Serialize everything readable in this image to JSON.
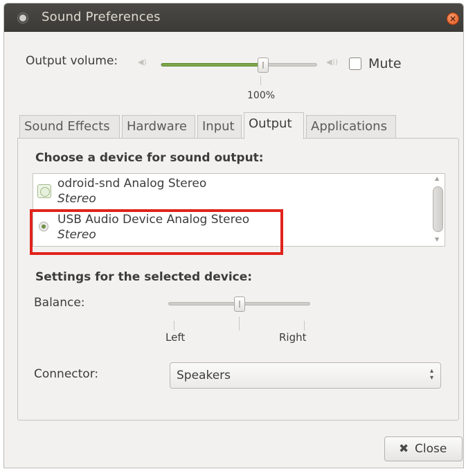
{
  "window": {
    "title": "Sound Preferences",
    "title_icon": "speaker-icon",
    "close_icon": "close-icon"
  },
  "volume": {
    "label": "Output volume:",
    "level_percent": 100,
    "value_text": "100%",
    "mute_label": "Mute",
    "muted": false,
    "low_icon": "speaker-low-icon",
    "high_icon": "speaker-high-icon"
  },
  "tabs": [
    {
      "label": "Sound Effects",
      "active": false
    },
    {
      "label": "Hardware",
      "active": false
    },
    {
      "label": "Input",
      "active": false
    },
    {
      "label": "Output",
      "active": true
    },
    {
      "label": "Applications",
      "active": false
    }
  ],
  "output": {
    "choose_heading": "Choose a device for sound output:",
    "devices": [
      {
        "name": "odroid-snd Analog Stereo",
        "profile": "Stereo",
        "selected": false
      },
      {
        "name": "USB Audio Device Analog Stereo",
        "profile": "Stereo",
        "selected": true
      }
    ],
    "settings_heading": "Settings for the selected device:",
    "balance_label": "Balance:",
    "balance_left": "Left",
    "balance_right": "Right",
    "balance_value": 0.5,
    "connector_label": "Connector:",
    "connector_value": "Speakers"
  },
  "footer": {
    "close_label": "Close",
    "close_icon": "close-x-icon"
  },
  "colors": {
    "accent": "#7ea64a",
    "highlight": "#e0241c",
    "titlebar": "#3b3a36",
    "close_button": "#e2531b"
  }
}
